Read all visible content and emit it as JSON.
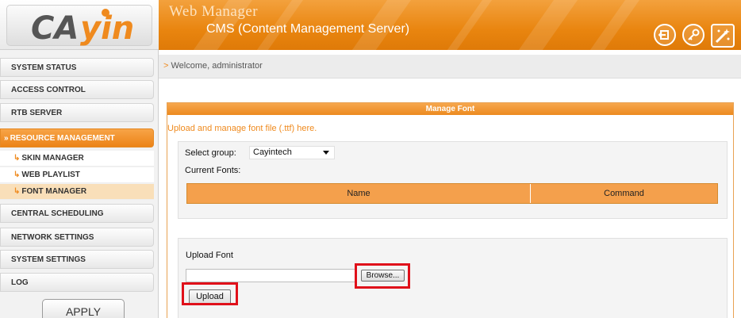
{
  "header": {
    "logo_text": "CAYIN",
    "title": "Web Manager",
    "subtitle": "CMS (Content Management Server)",
    "icons": [
      "logout-icon",
      "password-key-icon",
      "wizard-icon"
    ]
  },
  "welcome": {
    "chevron": ">",
    "text": "Welcome, administrator"
  },
  "sidebar": {
    "items": [
      {
        "label": "SYSTEM STATUS"
      },
      {
        "label": "ACCESS CONTROL"
      },
      {
        "label": "RTB SERVER"
      },
      {
        "label": "RESOURCE MANAGEMENT",
        "active": true
      },
      {
        "label": "CENTRAL SCHEDULING"
      },
      {
        "label": "NETWORK SETTINGS"
      },
      {
        "label": "SYSTEM SETTINGS"
      },
      {
        "label": "LOG"
      }
    ],
    "sub_items": [
      {
        "label": "SKIN MANAGER"
      },
      {
        "label": "WEB PLAYLIST"
      },
      {
        "label": "FONT MANAGER",
        "active": true
      }
    ],
    "apply_label": "APPLY",
    "active_marker": "»"
  },
  "panel": {
    "title": "Manage Font",
    "description": "Upload and manage font file (.ttf) here.",
    "select_group_label": "Select group:",
    "select_group_value": "Cayintech",
    "current_fonts_label": "Current Fonts:",
    "table_headers": [
      "Name",
      "Command"
    ],
    "upload_label": "Upload Font",
    "browse_label": "Browse...",
    "upload_button_label": "Upload"
  },
  "colors": {
    "accent": "#ef8a1e",
    "highlight": "#e0101a"
  }
}
